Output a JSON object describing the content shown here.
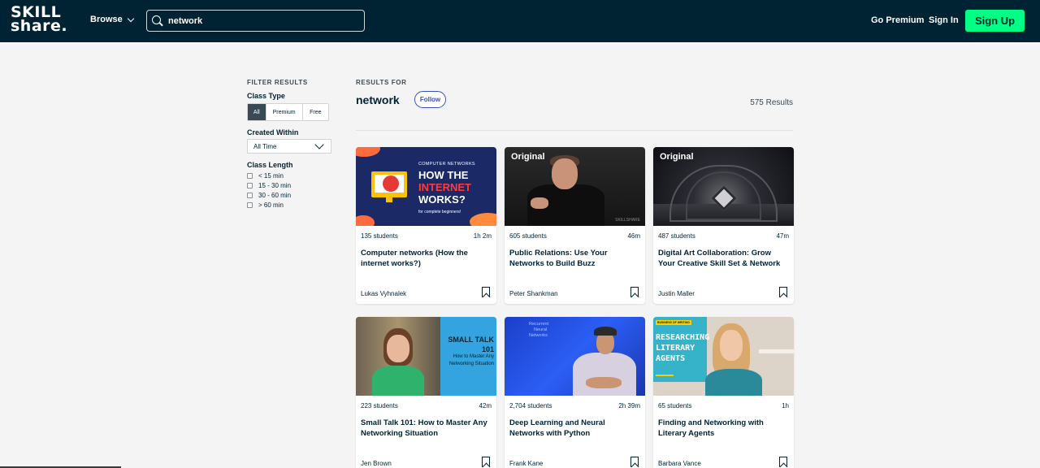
{
  "header": {
    "logo_line1": "SKILL",
    "logo_line2": "share.",
    "browse_label": "Browse",
    "search_value": "network",
    "go_premium_label": "Go Premium",
    "sign_in_label": "Sign In",
    "sign_up_label": "Sign Up"
  },
  "filters": {
    "title": "FILTER RESULTS",
    "class_type_label": "Class Type",
    "class_type_options": [
      "All",
      "Premium",
      "Free"
    ],
    "class_type_selected": "All",
    "created_within_label": "Created Within",
    "created_within_value": "All Time",
    "class_length_label": "Class Length",
    "class_length_options": [
      "< 15 min",
      "15 - 30 min",
      "30 - 60 min",
      "> 60 min"
    ]
  },
  "results": {
    "results_for_label": "RESULTS FOR",
    "query": "network",
    "follow_label": "Follow",
    "count_label": "575 Results"
  },
  "cards": [
    {
      "students": "135 students",
      "duration": "1h 2m",
      "title": "Computer networks (How the internet works?)",
      "author": "Lukas Vyhnalek",
      "original_badge": "",
      "thumb_text": {
        "kicker": "COMPUTER NETWORKS",
        "line1": "HOW THE",
        "line2": "INTERNET",
        "line3": "WORKS?",
        "footer": "for complete beginners!"
      }
    },
    {
      "students": "605 students",
      "duration": "46m",
      "title": "Public Relations: Use Your Networks to Build Buzz",
      "author": "Peter Shankman",
      "original_badge": "Original",
      "thumb_text": {
        "watermark": "SKILLSHARE"
      }
    },
    {
      "students": "487 students",
      "duration": "47m",
      "title": "Digital Art Collaboration: Grow Your Creative Skill Set & Network",
      "author": "Justin Maller",
      "original_badge": "Original"
    },
    {
      "students": "223 students",
      "duration": "42m",
      "title": "Small Talk 101: How to Master Any Networking Situation",
      "author": "Jen Brown",
      "original_badge": "",
      "thumb_text": {
        "line1": "SMALL TALK",
        "line2": "101",
        "sub": "How to Master Any Networking Situation"
      }
    },
    {
      "students": "2,704 students",
      "duration": "2h 39m",
      "title": "Deep Learning and Neural Networks with Python",
      "author": "Frank Kane",
      "original_badge": "",
      "thumb_text": {
        "line1": "Recurrent",
        "line2": "Neural",
        "line3": "Networks"
      }
    },
    {
      "students": "65 students",
      "duration": "1h",
      "title": "Finding and Networking with Literary Agents",
      "author": "Barbara Vance",
      "original_badge": "",
      "thumb_text": {
        "tag": "BUSINESS OF WRITING",
        "line1": "RESEARCHING",
        "line2": "LITERARY",
        "line3": "AGENTS"
      }
    }
  ],
  "colors": {
    "header_bg": "#002333",
    "signup_bg": "#00ff84",
    "follow_accent": "#3a4eb8",
    "page_bg": "#f4f4f4"
  },
  "icons": [
    "search-icon",
    "chevron-down-icon",
    "bookmark-icon",
    "checkbox-icon"
  ]
}
